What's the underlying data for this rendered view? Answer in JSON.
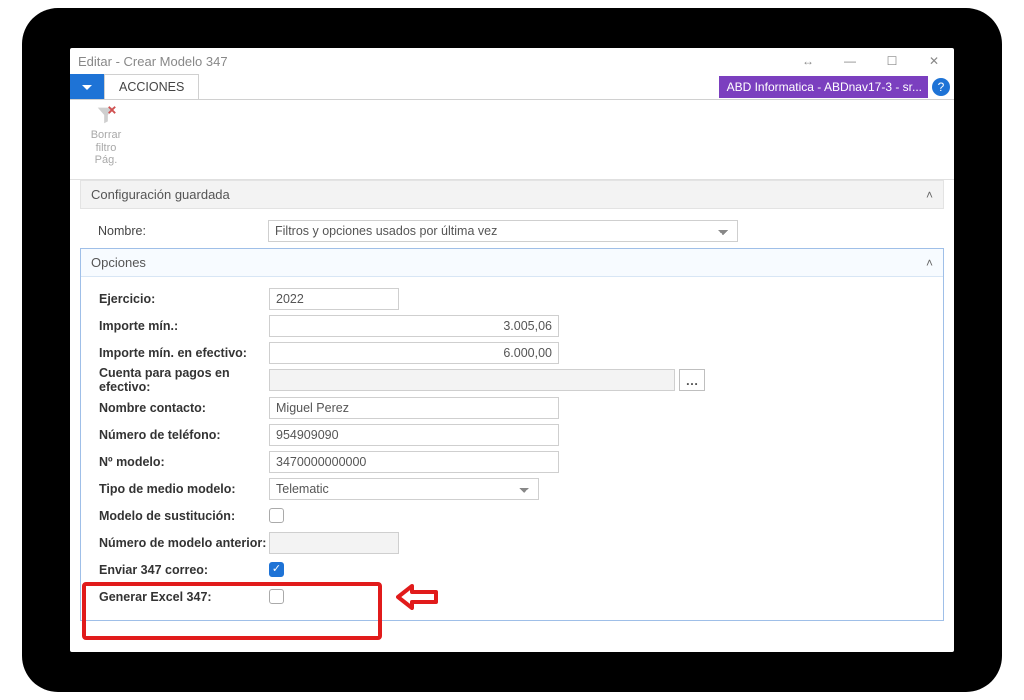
{
  "window": {
    "title": "Editar - Crear Modelo 347"
  },
  "ribbon": {
    "tab": "ACCIONES",
    "clear_filter_l1": "Borrar",
    "clear_filter_l2": "filtro",
    "clear_filter_l3": "Pág."
  },
  "env": {
    "label": "ABD Informatica - ABDnav17-3 - sr..."
  },
  "saved_config": {
    "header": "Configuración guardada",
    "name_label": "Nombre:",
    "name_value": "Filtros y opciones usados por última vez"
  },
  "options": {
    "header": "Opciones",
    "ejercicio_label": "Ejercicio:",
    "ejercicio_value": "2022",
    "importe_min_label": "Importe mín.:",
    "importe_min_value": "3.005,06",
    "importe_efectivo_label": "Importe mín. en efectivo:",
    "importe_efectivo_value": "6.000,00",
    "cuenta_pagos_label": "Cuenta para pagos en efectivo:",
    "cuenta_pagos_value": "",
    "nombre_contacto_label": "Nombre contacto:",
    "nombre_contacto_value": "Miguel Perez",
    "telefono_label": "Número de teléfono:",
    "telefono_value": "954909090",
    "n_modelo_label": "Nº modelo:",
    "n_modelo_value": "3470000000000",
    "tipo_medio_label": "Tipo de medio modelo:",
    "tipo_medio_value": "Telematic",
    "modelo_sust_label": "Modelo de sustitución:",
    "modelo_sust_checked": false,
    "num_mod_ant_label": "Número de modelo anterior:",
    "num_mod_ant_value": "",
    "enviar_correo_label": "Enviar 347 correo:",
    "enviar_correo_checked": true,
    "generar_excel_label": "Generar Excel 347:",
    "generar_excel_checked": false
  }
}
